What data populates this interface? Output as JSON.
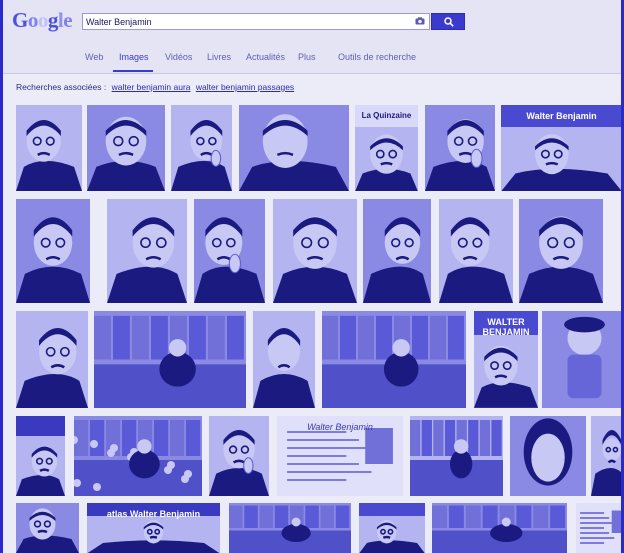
{
  "header": {
    "logo_letters": [
      "G",
      "o",
      "o",
      "g",
      "l",
      "e"
    ],
    "search_value": "Walter Benjamin",
    "search_button_icon": "search-icon",
    "camera_icon": "camera-icon"
  },
  "tabs": [
    {
      "label": "Web",
      "active": false
    },
    {
      "label": "Images",
      "active": true
    },
    {
      "label": "Vidéos",
      "active": false
    },
    {
      "label": "Livres",
      "active": false
    },
    {
      "label": "Actualités",
      "active": false
    },
    {
      "label": "Plus",
      "active": false
    },
    {
      "label": "Outils de recherche",
      "active": false
    }
  ],
  "related": {
    "prefix": "Recherches associées :",
    "links": [
      "walter benjamin aura",
      "walter benjamin passages"
    ]
  },
  "thumbnails": [
    {
      "row": 1,
      "subject": "portrait-glasses"
    },
    {
      "row": 1,
      "subject": "portrait-glasses"
    },
    {
      "row": 1,
      "subject": "portrait-hand"
    },
    {
      "row": 1,
      "subject": "portrait-profile"
    },
    {
      "row": 1,
      "subject": "magazine-cover",
      "text": "La Quinzaine"
    },
    {
      "row": 1,
      "subject": "portrait-hand"
    },
    {
      "row": 1,
      "subject": "book-cover-portrait",
      "text": "Walter Benjamin"
    },
    {
      "row": 2,
      "subject": "portrait-glasses"
    },
    {
      "row": 2,
      "subject": "portrait-closeup"
    },
    {
      "row": 2,
      "subject": "portrait-hand"
    },
    {
      "row": 2,
      "subject": "portrait-reading"
    },
    {
      "row": 2,
      "subject": "portrait-library"
    },
    {
      "row": 2,
      "subject": "portrait-seated"
    },
    {
      "row": 2,
      "subject": "portrait-glasses"
    },
    {
      "row": 3,
      "subject": "portrait-glasses"
    },
    {
      "row": 3,
      "subject": "library-reading-room"
    },
    {
      "row": 3,
      "subject": "portrait-profile"
    },
    {
      "row": 3,
      "subject": "library-reading-room"
    },
    {
      "row": 3,
      "subject": "book-cover-portrait",
      "text": "WALTER BENJAMIN"
    },
    {
      "row": 3,
      "subject": "puppet-doll"
    },
    {
      "row": 4,
      "subject": "book-cover",
      "text": ""
    },
    {
      "row": 4,
      "subject": "crowd"
    },
    {
      "row": 4,
      "subject": "portrait-hand"
    },
    {
      "row": 4,
      "subject": "handwritten-document",
      "text": "Walter Benjamin"
    },
    {
      "row": 4,
      "subject": "street-scene"
    },
    {
      "row": 4,
      "subject": "portrait-woman"
    },
    {
      "row": 4,
      "subject": "portrait-glasses"
    },
    {
      "row": 5,
      "subject": "portrait-glasses"
    },
    {
      "row": 5,
      "subject": "book-cover",
      "text": "atlas Walter Benjamin"
    },
    {
      "row": 5,
      "subject": "arcade"
    },
    {
      "row": 5,
      "subject": "book-cover-portrait",
      "text": ""
    },
    {
      "row": 5,
      "subject": "street-scene"
    },
    {
      "row": 5,
      "subject": "document"
    }
  ],
  "colors": {
    "accent": "#3a3acc",
    "tint_dark": "#1a1a80",
    "tint_mid": "#5a5ad8",
    "tint_light": "#c8c8f4"
  }
}
